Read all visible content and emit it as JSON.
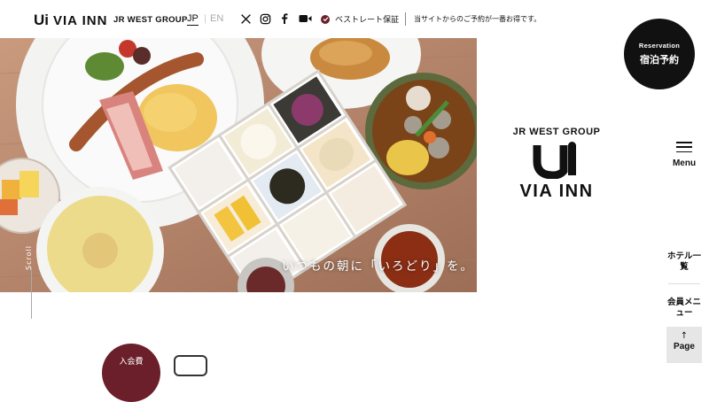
{
  "header": {
    "logo_mark": "Ui",
    "logo_text": "VIA INN",
    "logo_group": "JR WEST GROUP",
    "lang_jp": "JP",
    "lang_sep": "|",
    "lang_en": "EN",
    "social_icons": [
      "x-icon",
      "instagram-icon",
      "facebook-icon",
      "youtube-icon"
    ],
    "best_rate": "ベストレート保証",
    "notice": "当サイトからのご予約が一番お得です。"
  },
  "reservation": {
    "label_en": "Reservation",
    "label_ja": "宿泊予約"
  },
  "hero": {
    "caption": "いつもの朝に「いろどり」を。",
    "scroll_label": "Scroll",
    "slide_count": 3,
    "active_slide": 2
  },
  "brand": {
    "group": "JR WEST GROUP",
    "name": "VIA INN"
  },
  "sidenav": {
    "menu_label": "Menu",
    "hotel_list": "ホテル一覧",
    "member_menu": "会員メニュー",
    "page_top": "Page"
  },
  "bottom": {
    "join_label": "入会費"
  },
  "colors": {
    "accent": "#6b1f2a",
    "text": "#111111",
    "background": "#ffffff"
  }
}
